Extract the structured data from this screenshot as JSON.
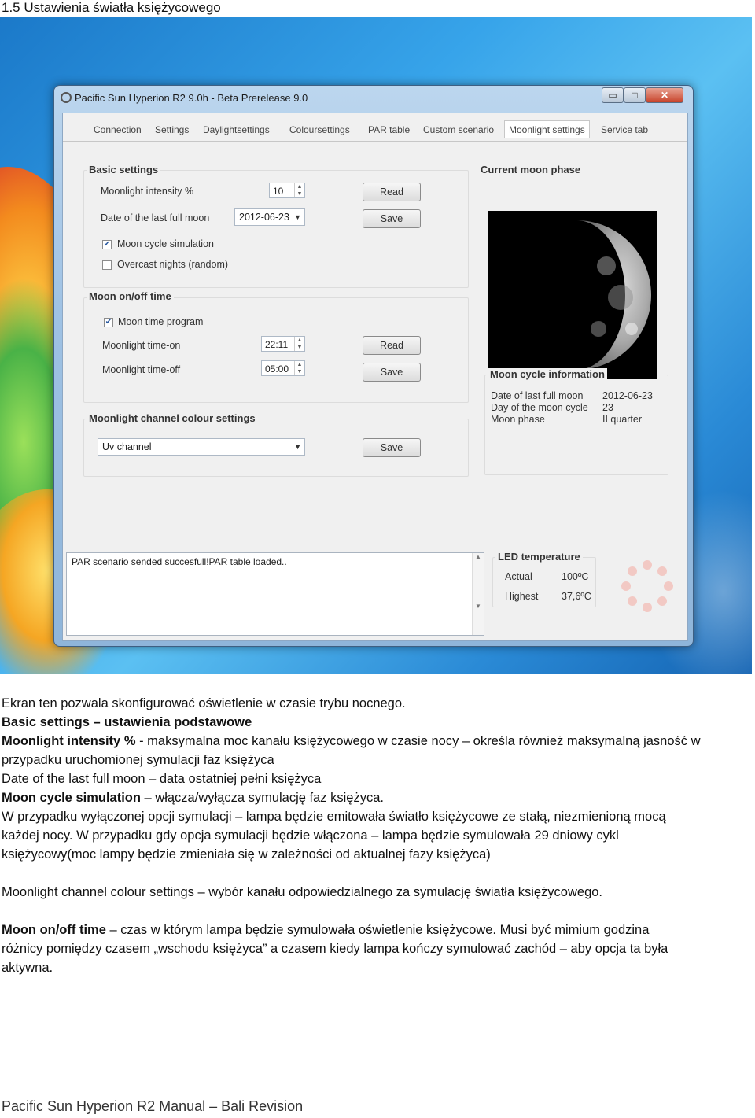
{
  "doc": {
    "heading": "1.5 Ustawienia światła księżycowego",
    "footer": "Pacific Sun Hyperion R2 Manual – Bali Revision"
  },
  "window": {
    "title": "Pacific Sun Hyperion R2 9.0h - Beta Prerelease 9.0",
    "controls": {
      "minimize": "▭",
      "maximize": "□",
      "close": "✕"
    }
  },
  "tabs": [
    "Connection",
    "Settings",
    "Daylightsettings",
    "Coloursettings",
    "PAR table",
    "Custom scenario",
    "Moonlight settings",
    "Service tab"
  ],
  "basic": {
    "title": "Basic settings",
    "intensity_label": "Moonlight intensity %",
    "intensity_value": "10",
    "date_label": "Date of the last full moon",
    "date_value": "2012-06-23",
    "read": "Read",
    "save": "Save",
    "moon_cycle_sim": "Moon cycle simulation",
    "overcast": "Overcast nights (random)"
  },
  "onoff": {
    "title": "Moon on/off time",
    "program": "Moon time program",
    "on_label": "Moonlight time-on",
    "on_value": "22:11",
    "off_label": "Moonlight time-off",
    "off_value": "05:00",
    "read": "Read",
    "save": "Save"
  },
  "channel": {
    "title": "Moonlight channel colour settings",
    "selected": "Uv channel",
    "save": "Save"
  },
  "phase": {
    "title": "Current moon phase"
  },
  "cycle": {
    "title": "Moon cycle information",
    "rows": [
      {
        "label": "Date of last full moon",
        "value": "2012-06-23"
      },
      {
        "label": "Day of the moon cycle",
        "value": "23"
      },
      {
        "label": "Moon phase",
        "value": "II quarter"
      }
    ]
  },
  "log": {
    "text": "PAR scenario sended succesfull!PAR table loaded.."
  },
  "led": {
    "title": "LED temperature",
    "actual_label": "Actual",
    "actual_value": "100ºC",
    "highest_label": "Highest",
    "highest_value": "37,6ºC"
  },
  "body": {
    "p1": "Ekran ten pozwala skonfigurować oświetlenie w czasie trybu nocnego.",
    "p2": "Basic settings – ustawienia podstawowe",
    "p3_bold": "Moonlight intensity %",
    "p3_rest": " - maksymalna moc kanału księżycowego w czasie nocy – określa również maksymalną jasność w",
    "p4": "przypadku uruchomionej symulacji faz księżyca",
    "p5": "Date of the last full moon – data ostatniej pełni księżyca",
    "p6_bold": "Moon cycle simulation",
    "p6_rest": " – włącza/wyłącza symulację faz księżyca.",
    "p7": "W przypadku wyłączonej opcji symulacji – lampa będzie emitowała światło księżycowe ze stałą, niezmienioną mocą",
    "p8": "każdej nocy. W przypadku gdy opcja symulacji będzie włączona – lampa będzie symulowała 29 dniowy cykl",
    "p9": "księżycowy(moc lampy będzie zmieniała się w zależności od aktualnej fazy księżyca)",
    "p10": "Moonlight channel colour settings – wybór kanału odpowiedzialnego za symulację światła księżycowego.",
    "p11_bold": "Moon on/off time",
    "p11_rest": " –  czas w którym lampa będzie symulowała oświetlenie księżycowe. Musi być mimium godzina",
    "p12": "różnicy pomiędzy czasem „wschodu księżyca” a czasem kiedy lampa kończy symulować zachód – aby opcja ta była",
    "p13": "aktywna."
  }
}
